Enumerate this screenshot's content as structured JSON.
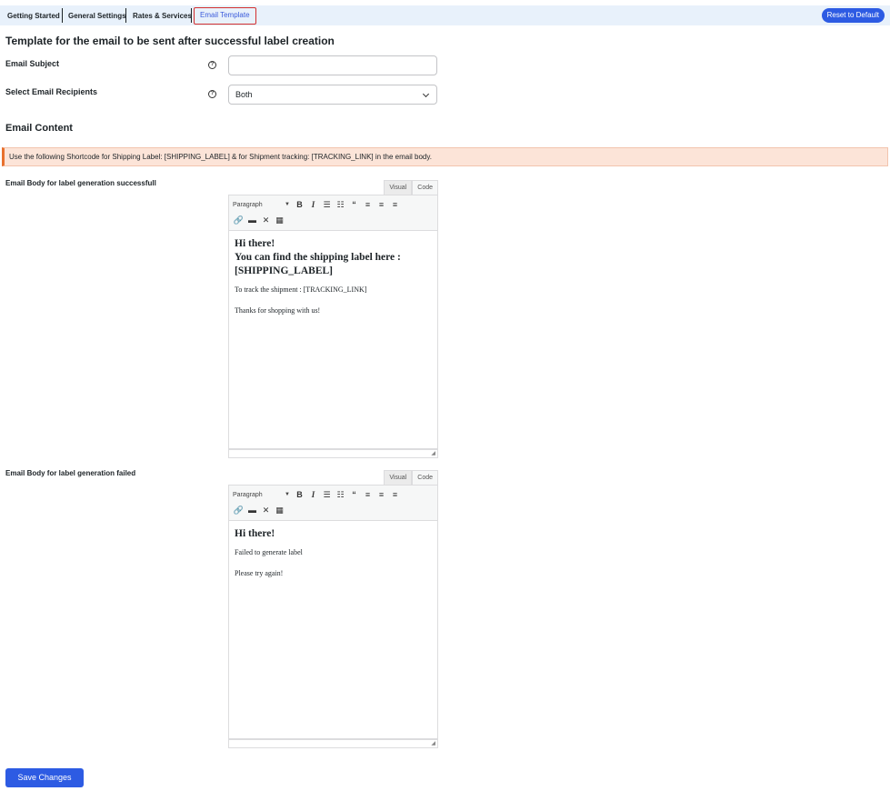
{
  "tabs": [
    {
      "label": "Getting Started"
    },
    {
      "label": "General Settings"
    },
    {
      "label": "Rates & Services"
    },
    {
      "label": "Email Template"
    }
  ],
  "reset_label": "Reset to Default",
  "page_title": "Template for the email to be sent after successful label creation",
  "subject": {
    "label": "Email Subject",
    "value": ""
  },
  "recipients": {
    "label": "Select Email Recipients",
    "value": "Both"
  },
  "content_title": "Email Content",
  "notice": "Use the following Shortcode for Shipping Label: [SHIPPING_LABEL] & for Shipment tracking: [TRACKING_LINK] in the email body.",
  "editors": [
    {
      "label": "Email Body for label generation successfull",
      "mode_visual": "Visual",
      "mode_code": "Code",
      "format": "Paragraph",
      "heading": "Hi there!\nYou can find the shipping label here : [SHIPPING_LABEL]",
      "para1": "To track the shipment : [TRACKING_LINK]",
      "para2": "Thanks for shopping with us!"
    },
    {
      "label": "Email Body for label generation failed",
      "mode_visual": "Visual",
      "mode_code": "Code",
      "format": "Paragraph",
      "heading": "Hi there!",
      "para1": "Failed to generate label",
      "para2": "Please try again!"
    }
  ],
  "toolbar_icons": [
    "bold-icon",
    "italic-icon",
    "bullet-list-icon",
    "numbered-list-icon",
    "blockquote-icon",
    "align-left-icon",
    "align-center-icon",
    "align-right-icon",
    "link-icon",
    "horizontal-line-icon",
    "fullscreen-icon",
    "toolbar-toggle-icon"
  ],
  "save_label": "Save Changes",
  "colors": {
    "accent": "#2d5be3",
    "notice_bg": "#fce4d8",
    "notice_border": "#e8712e",
    "active_tab_border": "#d32f2f"
  }
}
